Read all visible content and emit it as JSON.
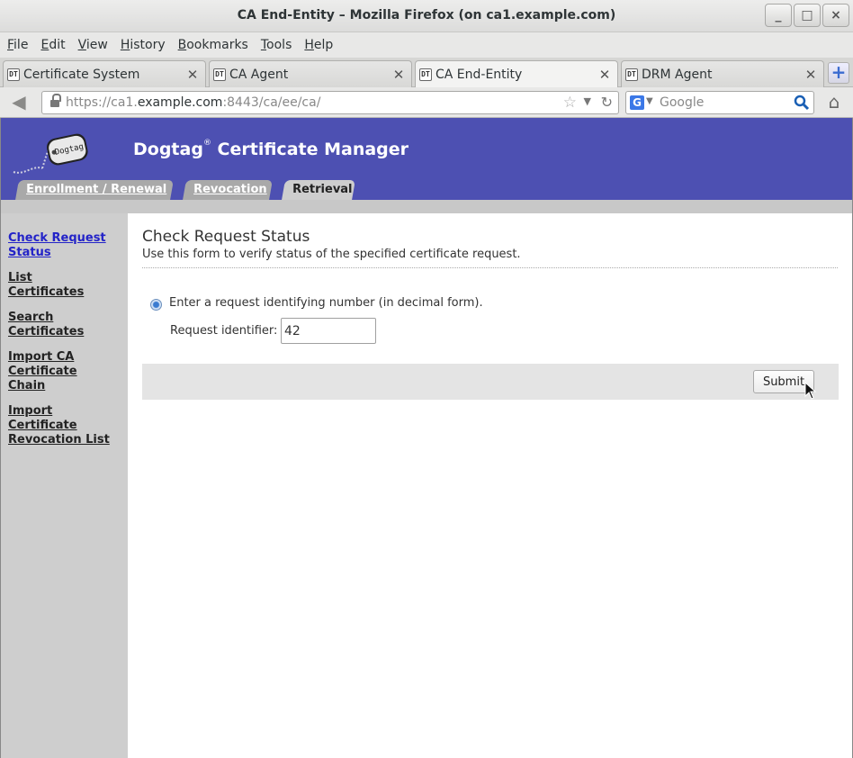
{
  "window": {
    "title": "CA End-Entity – Mozilla Firefox (on ca1.example.com)",
    "minimize": "_",
    "maximize": "□",
    "close": "×"
  },
  "menu": [
    "File",
    "Edit",
    "View",
    "History",
    "Bookmarks",
    "Tools",
    "Help"
  ],
  "tabs": [
    {
      "label": "Certificate System",
      "favicon": "DT",
      "active": false
    },
    {
      "label": "CA Agent",
      "favicon": "DT",
      "active": false
    },
    {
      "label": "CA End-Entity",
      "favicon": "DT",
      "active": true
    },
    {
      "label": "DRM Agent",
      "favicon": "DT",
      "active": false
    }
  ],
  "navbar": {
    "url_prefix": "https://ca1.",
    "url_domain": "example.com",
    "url_suffix": ":8443/ca/ee/ca/",
    "search_placeholder": "Google",
    "search_engine": "G"
  },
  "header": {
    "brand": "Dogtag",
    "brand_mark": "®",
    "brand_rest": " Certificate Manager",
    "logo_text": "Dogtag",
    "tabs": [
      {
        "label": "Enrollment / Renewal",
        "active": false
      },
      {
        "label": "Revocation",
        "active": false
      },
      {
        "label": "Retrieval",
        "active": true
      }
    ]
  },
  "sidebar": {
    "items": [
      {
        "label": "Check Request Status",
        "active": true
      },
      {
        "label": "List Certificates",
        "active": false
      },
      {
        "label": "Search Certificates",
        "active": false
      },
      {
        "label": "Import CA Certificate Chain",
        "active": false
      },
      {
        "label": "Import Certificate Revocation List",
        "active": false
      }
    ]
  },
  "form": {
    "title": "Check Request Status",
    "description": "Use this form to verify status of the specified certificate request.",
    "radio_label": "Enter a request identifying number (in decimal form).",
    "field_label": "Request identifier:",
    "field_value": "42",
    "submit_label": "Submit"
  },
  "colors": {
    "header_bg": "#4d50b2",
    "sidebar_bg": "#cecece",
    "link_active": "#2323c8"
  }
}
